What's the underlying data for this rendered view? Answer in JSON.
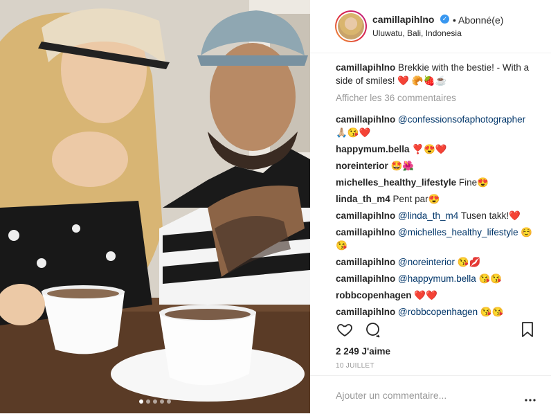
{
  "post": {
    "username": "camillapihlno",
    "follow_label": "• Abonné(e)",
    "location": "Uluwatu, Bali, Indonesia"
  },
  "caption": {
    "user": "camillapihlno",
    "text": "Brekkie with the bestie! - With a side of smiles! ❤️ 🥐🍓☕"
  },
  "view_all": "Afficher les 36 commentaires",
  "comments": [
    {
      "user": "camillapihlno",
      "mention": "@confessionsofaphotographer",
      "text": " 🙏🏼😘❤️"
    },
    {
      "user": "happymum.bella",
      "mention": "",
      "text": "❣️😍❤️"
    },
    {
      "user": "noreinterior",
      "mention": "",
      "text": "🤩🌺"
    },
    {
      "user": "michelles_healthy_lifestyle",
      "mention": "",
      "text": "Fine😍"
    },
    {
      "user": "linda_th_m4",
      "mention": "",
      "text": "Pent par😍"
    },
    {
      "user": "camillapihlno",
      "mention": "@linda_th_m4",
      "text": " Tusen takk!❤️"
    },
    {
      "user": "camillapihlno",
      "mention": "@michelles_healthy_lifestyle",
      "text": " ☺️😘"
    },
    {
      "user": "camillapihlno",
      "mention": "@noreinterior",
      "text": " 😘💋"
    },
    {
      "user": "camillapihlno",
      "mention": "@happymum.bella",
      "text": " 😘😘"
    },
    {
      "user": "robbcopenhagen",
      "mention": "",
      "text": "❤️❤️"
    },
    {
      "user": "camillapihlno",
      "mention": "@robbcopenhagen",
      "text": " 😘😘"
    }
  ],
  "likes": "2 249 J'aime",
  "date": "10 JUILLET",
  "comment_placeholder": "Ajouter un commentaire...",
  "icons": {
    "like": "heart-icon",
    "comment": "comment-icon",
    "save": "bookmark-icon",
    "more": "more-options-icon",
    "verified": "verified-badge-icon"
  },
  "colors": {
    "text": "#262626",
    "secondary": "#999999",
    "mention": "#003569",
    "verified": "#3897f0"
  }
}
